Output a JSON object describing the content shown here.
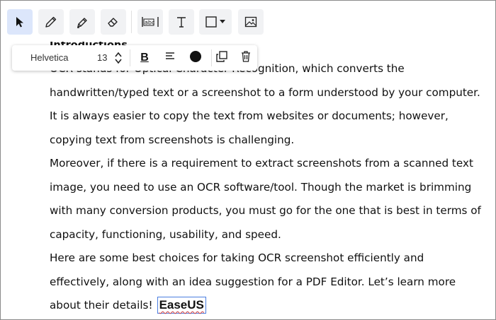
{
  "toolbar": {
    "tools": [
      {
        "name": "select-tool",
        "icon": "cursor-arrow-icon",
        "active": true
      },
      {
        "name": "pencil-tool",
        "icon": "pencil-icon"
      },
      {
        "name": "highlighter-tool",
        "icon": "highlighter-icon"
      },
      {
        "name": "eraser-tool",
        "icon": "eraser-icon"
      },
      {
        "name": "ocr-text-tool",
        "icon": "ocr-icon"
      },
      {
        "name": "text-tool",
        "icon": "text-t-icon"
      },
      {
        "name": "shape-tool",
        "icon": "rectangle-dropdown-icon"
      },
      {
        "name": "image-tool",
        "icon": "image-icon"
      }
    ],
    "ocr_icon_text": "abc"
  },
  "format_bar": {
    "font": "Helvetica",
    "size": "13",
    "bold_label": "B",
    "color": "#111111"
  },
  "document": {
    "heading": "Introductions",
    "lines": [
      "OCR stands for Optical Character Recognition, which converts the",
      "handwritten/typed text or a screenshot to a form understood by your computer.",
      "It is always easier to copy the text from websites or documents; however,",
      "copying text from screenshots is challenging.",
      "Moreover, if there is a requirement to extract screenshots from a scanned text",
      "image, you need to use an OCR software/tool. Though the market is brimming",
      "with many conversion products, you must go for the one that is best in terms of",
      "capacity, functioning, usability, and speed.",
      "Here are some best choices for taking OCR screenshot efficiently and",
      "effectively, along with an idea suggestion for a PDF Editor. Let’s learn more",
      "about their details!"
    ],
    "brand_text": "EaseUS"
  },
  "colors": {
    "active_tool_bg": "#dce6fb",
    "tool_bg": "#f1f2f4",
    "selection_border": "#4a7de0",
    "spellcheck_underline": "#d23b3b"
  }
}
